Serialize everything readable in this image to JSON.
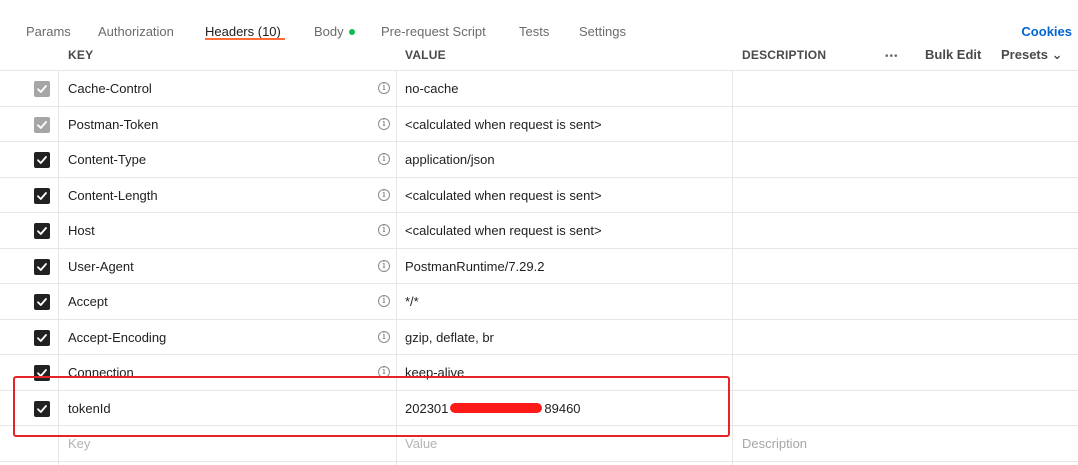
{
  "tabs": [
    {
      "label": "Params"
    },
    {
      "label": "Authorization"
    },
    {
      "label": "Headers (10)"
    },
    {
      "label": "Body"
    },
    {
      "label": "Pre-request Script"
    },
    {
      "label": "Tests"
    },
    {
      "label": "Settings"
    }
  ],
  "cookies_label": "Cookies",
  "columns": {
    "key": "KEY",
    "value": "VALUE",
    "description": "DESCRIPTION",
    "more": "•••",
    "bulk_edit": "Bulk Edit",
    "presets": "Presets ⌄"
  },
  "rows": [
    {
      "key": "Cache-Control",
      "value": "no-cache",
      "checked": true,
      "disabled": true
    },
    {
      "key": "Postman-Token",
      "value": "<calculated when request is sent>",
      "checked": true,
      "disabled": true
    },
    {
      "key": "Content-Type",
      "value": "application/json",
      "checked": true,
      "disabled": false
    },
    {
      "key": "Content-Length",
      "value": "<calculated when request is sent>",
      "checked": true,
      "disabled": false
    },
    {
      "key": "Host",
      "value": "<calculated when request is sent>",
      "checked": true,
      "disabled": false
    },
    {
      "key": "User-Agent",
      "value": "PostmanRuntime/7.29.2",
      "checked": true,
      "disabled": false
    },
    {
      "key": "Accept",
      "value": "*/*",
      "checked": true,
      "disabled": false
    },
    {
      "key": "Accept-Encoding",
      "value": "gzip, deflate, br",
      "checked": true,
      "disabled": false
    },
    {
      "key": "Connection",
      "value": "keep-alive",
      "checked": true,
      "disabled": false
    }
  ],
  "custom_row": {
    "key": "tokenId",
    "value_prefix": "202301",
    "value_suffix": "89460"
  },
  "new_row": {
    "key_placeholder": "Key",
    "value_placeholder": "Value",
    "description_placeholder": "Description"
  },
  "info_glyph": "i",
  "colors": {
    "accent": "#ff6c37",
    "link": "#0265d2",
    "body_dot": "#0cbb52",
    "highlight": "#e5242a"
  }
}
